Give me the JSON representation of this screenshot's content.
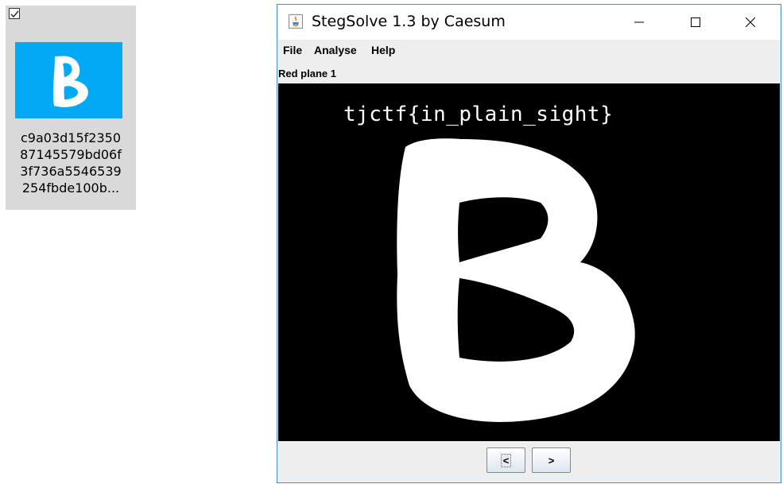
{
  "desktop_file": {
    "checked": true,
    "thumbnail_color": "#03a9f4",
    "name_lines": [
      "c9a03d15f2350",
      "87145579bd06f",
      "3f736a5546539",
      "254fbde100b..."
    ]
  },
  "window": {
    "title": "StegSolve 1.3 by Caesum",
    "menu": {
      "file": "File",
      "analyse": "Analyse",
      "help": "Help"
    },
    "plane_label": "Red plane 1",
    "image_text": "tjctf{in_plain_sight}",
    "buttons": {
      "prev": "<",
      "next": ">"
    },
    "accent_color": "#3c8fd6"
  }
}
